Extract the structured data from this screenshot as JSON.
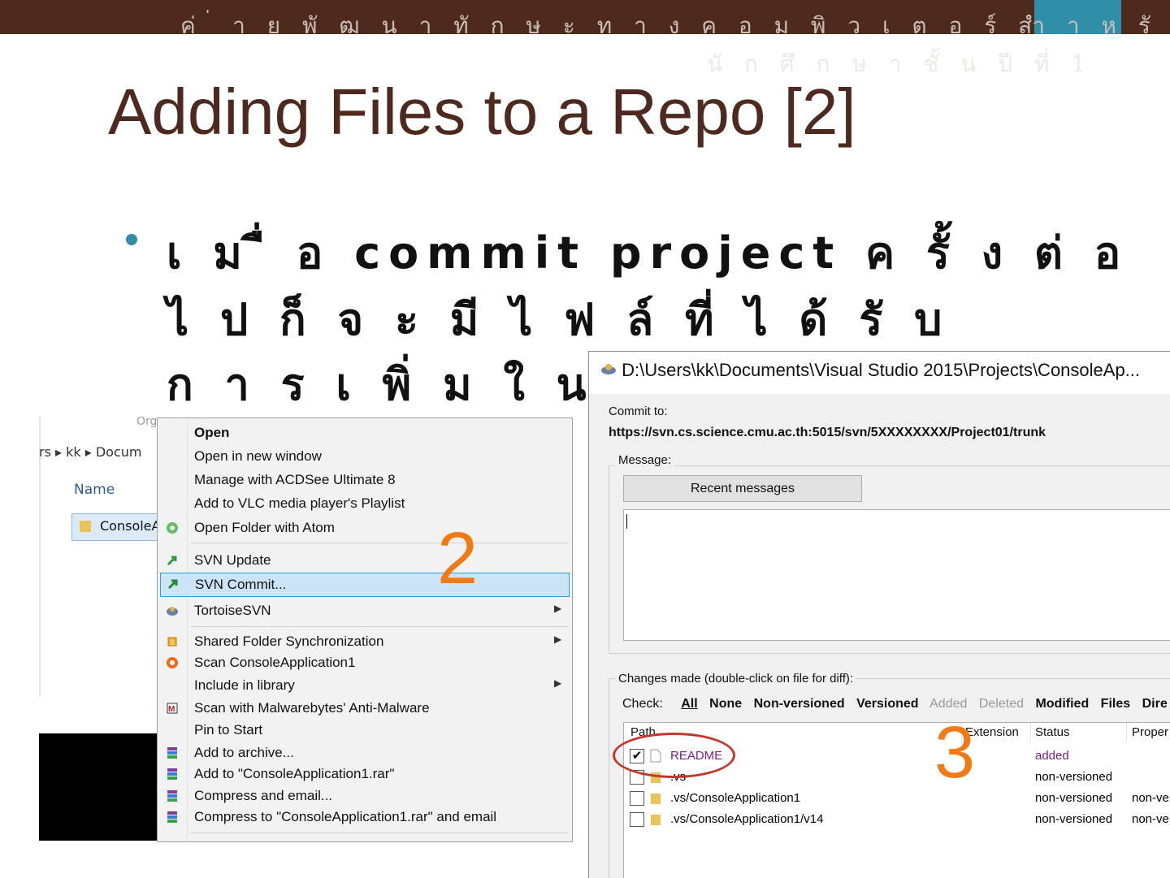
{
  "header": {
    "banner_line1": "ค่ ่ า ย พั ฒ น า ทั ก ษ ะ ท า ง ค อ ม พิ ว เ ต อ ร์ สำ า ห รั บ",
    "banner_line2": "นั ก ศึ ก ษ า ชั้ น ปี ที่ 1",
    "accent_color": "#2f8fa8",
    "bar_color": "#4e2a1e"
  },
  "slide": {
    "title": "Adding Files to a Repo [2]",
    "bullet_lines": [
      "เ ม ื่ อ commit project ค รั้ ง ต่ อ",
      "ไ ป  ก็ จ ะ มี ไ ฟ ล์ ที่ ไ ด้ รั บ",
      "ก า ร เ พิ่ ม ใ น"
    ]
  },
  "explorer": {
    "organize_label": "Org",
    "breadcrumb": "rs ▸ kk ▸ Docum",
    "column_name": "Name",
    "selected_item": "ConsoleA"
  },
  "context_menu": {
    "items": [
      {
        "label": "Open",
        "bold": true,
        "icon": "none"
      },
      {
        "label": "Open in new window",
        "icon": "none"
      },
      {
        "label": "Manage with ACDSee Ultimate 8",
        "icon": "none"
      },
      {
        "label": "Add to VLC media player's Playlist",
        "icon": "none"
      },
      {
        "label": "Open Folder with Atom",
        "icon": "atom-icon"
      },
      {
        "label": "SVN Update",
        "icon": "svn-update-icon"
      },
      {
        "label": "SVN Commit...",
        "icon": "svn-commit-icon",
        "highlighted": true
      },
      {
        "label": "TortoiseSVN",
        "icon": "tortoise-icon",
        "submenu": true
      },
      {
        "label": "Shared Folder Synchronization",
        "icon": "sync-icon",
        "submenu": true
      },
      {
        "label": "Scan ConsoleApplication1",
        "icon": "scan-icon"
      },
      {
        "label": "Include in library",
        "icon": "none",
        "submenu": true
      },
      {
        "label": "Scan with Malwarebytes' Anti-Malware",
        "icon": "malwarebytes-icon"
      },
      {
        "label": "Pin to Start",
        "icon": "none"
      },
      {
        "label": "Add to archive...",
        "icon": "winrar-icon"
      },
      {
        "label": "Add to \"ConsoleApplication1.rar\"",
        "icon": "winrar-icon"
      },
      {
        "label": "Compress and email...",
        "icon": "winrar-icon"
      },
      {
        "label": "Compress to \"ConsoleApplication1.rar\" and email",
        "icon": "winrar-icon"
      }
    ],
    "step_number": "2"
  },
  "commit_dialog": {
    "title": "D:\\Users\\kk\\Documents\\Visual Studio 2015\\Projects\\ConsoleAp...",
    "commit_to_label": "Commit to:",
    "commit_url": "https://svn.cs.science.cmu.ac.th:5015/svn/5XXXXXXXX/Project01/trunk",
    "message_label": "Message:",
    "recent_messages_button": "Recent messages",
    "message_value": "",
    "changes_label": "Changes made (double-click on file for diff):",
    "check_label": "Check:",
    "check_filters": [
      "All",
      "None",
      "Non-versioned",
      "Versioned"
    ],
    "check_filters_disabled": [
      "Added",
      "Deleted"
    ],
    "check_filters_more": [
      "Modified",
      "Files",
      "Dire"
    ],
    "columns": {
      "path": "Path",
      "extension": "Extension",
      "status": "Status",
      "properties": "Proper"
    },
    "files": [
      {
        "path": "README",
        "status": "added",
        "props": "",
        "checked": true,
        "type": "file"
      },
      {
        "path": ".vs",
        "status": "non-versioned",
        "props": "",
        "checked": false,
        "type": "folder"
      },
      {
        "path": ".vs/ConsoleApplication1",
        "status": "non-versioned",
        "props": "non-ve",
        "checked": false,
        "type": "folder"
      },
      {
        "path": ".vs/ConsoleApplication1/v14",
        "status": "non-versioned",
        "props": "non-ve",
        "checked": false,
        "type": "folder"
      }
    ],
    "step_number": "3"
  }
}
